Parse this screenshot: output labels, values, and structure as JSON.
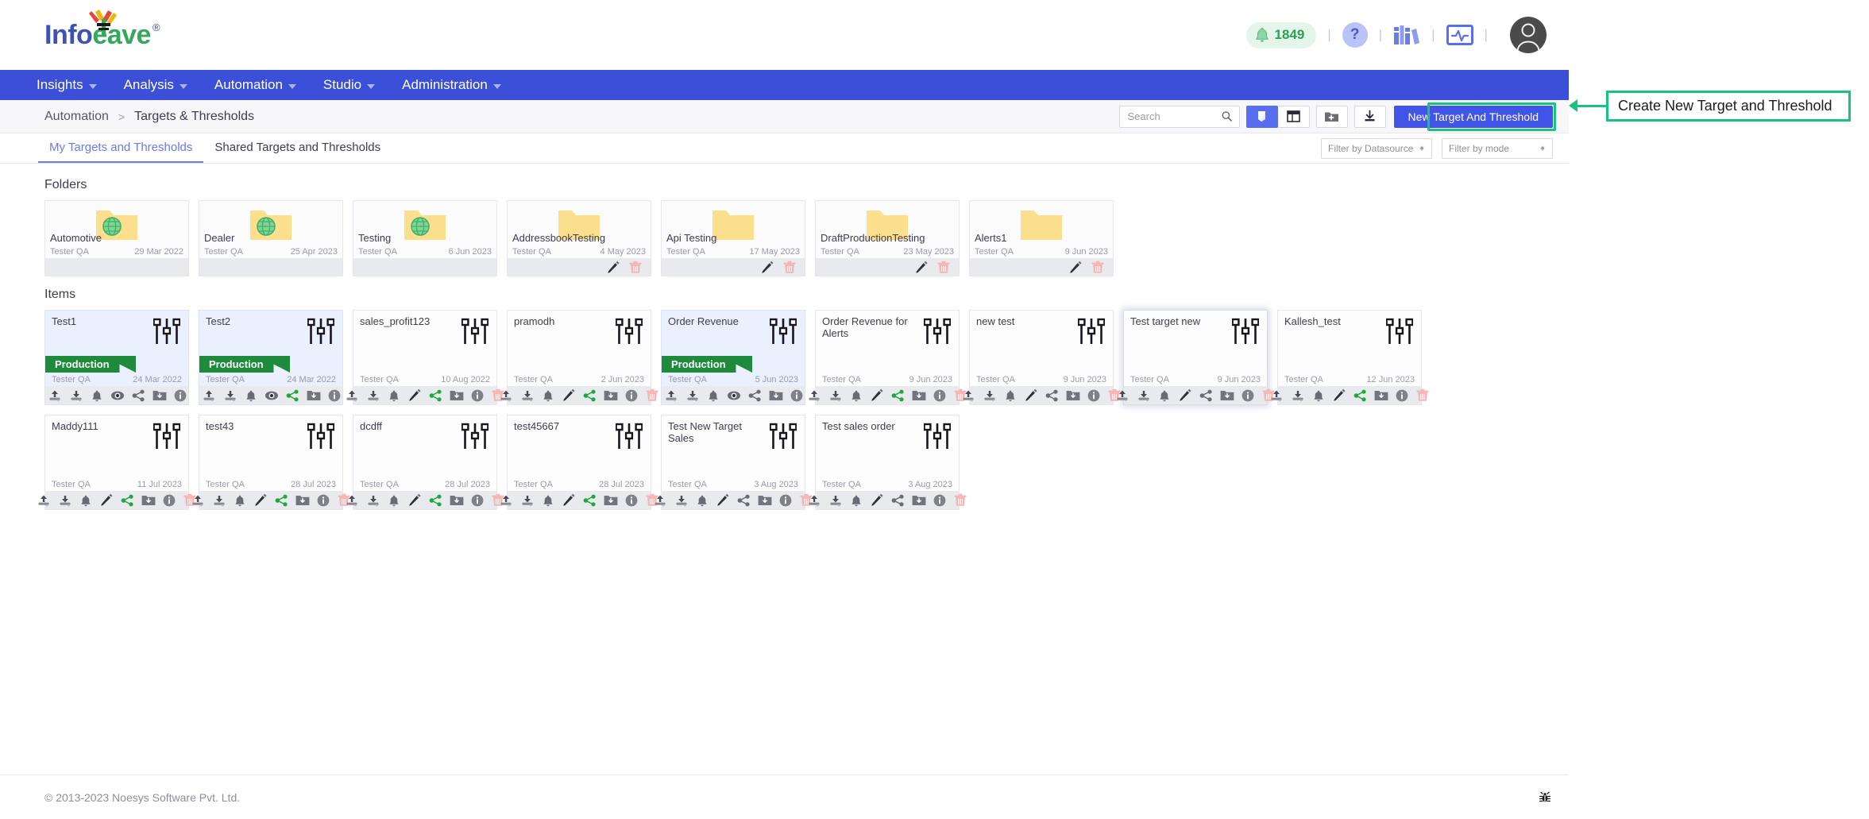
{
  "brand": {
    "name_part1": "Info",
    "name_part2": "eave",
    "trademark": "®"
  },
  "header": {
    "notification_count": "1849",
    "bell_icon": "bell-icon",
    "help_label": "?",
    "library_icon": "library-icon",
    "monitor_icon": "monitor-icon",
    "avatar_icon": "user-avatar-icon",
    "separator": "|",
    "accent_green": "#2e9e57",
    "accent_blue": "#3b4fd8"
  },
  "nav": {
    "items": [
      {
        "label": "Insights",
        "has_caret": true
      },
      {
        "label": "Analysis",
        "has_caret": true
      },
      {
        "label": "Automation",
        "has_caret": true
      },
      {
        "label": "Studio",
        "has_caret": true
      },
      {
        "label": "Administration",
        "has_caret": true
      }
    ]
  },
  "breadcrumb": {
    "parent": "Automation",
    "separator": ">",
    "current": "Targets & Thresholds"
  },
  "toolbar": {
    "search_placeholder": "Search",
    "search_value": "",
    "search_icon": "search-icon",
    "view_card_icon": "card-view-icon",
    "view_list_icon": "list-view-icon",
    "new_folder_icon": "new-folder-icon",
    "import_icon": "import-download-icon",
    "primary_button": "New Target And Threshold"
  },
  "tabs": [
    {
      "label": "My Targets and Thresholds",
      "active": true
    },
    {
      "label": "Shared Targets and Thresholds",
      "active": false
    }
  ],
  "filters": [
    {
      "label": "Filter by Datasource"
    },
    {
      "label": "Filter by mode"
    }
  ],
  "sections": {
    "folders_title": "Folders",
    "items_title": "Items"
  },
  "folders": [
    {
      "name": "Automotive",
      "owner": "Tester QA",
      "date": "29 Mar 2022",
      "shared": true,
      "actions": []
    },
    {
      "name": "Dealer",
      "owner": "Tester QA",
      "date": "25 Apr 2023",
      "shared": true,
      "actions": []
    },
    {
      "name": "Testing",
      "owner": "Tester QA",
      "date": "6 Jun 2023",
      "shared": true,
      "actions": []
    },
    {
      "name": "AddressbookTesting",
      "owner": "Tester QA",
      "date": "4 May 2023",
      "shared": false,
      "actions": [
        "edit",
        "delete"
      ]
    },
    {
      "name": "Api Testing",
      "owner": "Tester QA",
      "date": "17 May 2023",
      "shared": false,
      "actions": [
        "edit",
        "delete"
      ]
    },
    {
      "name": "DraftProductionTesting",
      "owner": "Tester QA",
      "date": "23 May 2023",
      "shared": false,
      "actions": [
        "edit",
        "delete"
      ]
    },
    {
      "name": "Alerts1",
      "owner": "Tester QA",
      "date": "9 Jun 2023",
      "shared": false,
      "actions": [
        "edit",
        "delete"
      ]
    }
  ],
  "items": [
    {
      "name": "Test1",
      "owner": "Tester QA",
      "date": "24 Mar 2022",
      "ribbon": "Production",
      "production": true,
      "hover": false,
      "actions": [
        "upload",
        "download",
        "bell",
        "eye",
        "share-off",
        "folder",
        "info"
      ]
    },
    {
      "name": "Test2",
      "owner": "Tester QA",
      "date": "24 Mar 2022",
      "ribbon": "Production",
      "production": true,
      "hover": false,
      "actions": [
        "upload",
        "download",
        "bell",
        "eye",
        "share-on",
        "folder",
        "info"
      ]
    },
    {
      "name": "sales_profit123",
      "owner": "Tester QA",
      "date": "10 Aug 2022",
      "ribbon": "",
      "production": false,
      "hover": false,
      "actions": [
        "upload",
        "download",
        "bell",
        "edit",
        "share-on",
        "folder",
        "info",
        "delete"
      ]
    },
    {
      "name": "pramodh",
      "owner": "Tester QA",
      "date": "2 Jun 2023",
      "ribbon": "",
      "production": false,
      "hover": false,
      "actions": [
        "upload",
        "download",
        "bell",
        "edit",
        "share-on",
        "folder",
        "info",
        "delete"
      ]
    },
    {
      "name": "Order Revenue",
      "owner": "Tester QA",
      "date": "5 Jun 2023",
      "ribbon": "Production",
      "production": true,
      "hover": false,
      "actions": [
        "upload",
        "download",
        "bell",
        "eye",
        "share-off",
        "folder",
        "info"
      ]
    },
    {
      "name": "Order Revenue for Alerts",
      "owner": "Tester QA",
      "date": "9 Jun 2023",
      "ribbon": "",
      "production": false,
      "hover": false,
      "actions": [
        "upload",
        "download",
        "bell",
        "edit",
        "share-on",
        "folder",
        "info",
        "delete"
      ]
    },
    {
      "name": "new test",
      "owner": "Tester QA",
      "date": "9 Jun 2023",
      "ribbon": "",
      "production": false,
      "hover": false,
      "actions": [
        "upload",
        "download",
        "bell",
        "edit",
        "share-off",
        "folder",
        "info",
        "delete"
      ]
    },
    {
      "name": "Test target new",
      "owner": "Tester QA",
      "date": "9 Jun 2023",
      "ribbon": "",
      "production": false,
      "hover": true,
      "actions": [
        "upload",
        "download",
        "bell",
        "edit",
        "share-off",
        "folder",
        "info",
        "delete"
      ]
    },
    {
      "name": "Kallesh_test",
      "owner": "Tester QA",
      "date": "12 Jun 2023",
      "ribbon": "",
      "production": false,
      "hover": false,
      "actions": [
        "upload",
        "download",
        "bell",
        "edit",
        "share-on",
        "folder",
        "info",
        "delete"
      ]
    },
    {
      "name": "Maddy111",
      "owner": "Tester QA",
      "date": "11 Jul 2023",
      "ribbon": "",
      "production": false,
      "hover": false,
      "actions": [
        "upload",
        "download",
        "bell",
        "edit",
        "share-on",
        "folder",
        "info",
        "delete"
      ]
    },
    {
      "name": "test43",
      "owner": "Tester QA",
      "date": "28 Jul 2023",
      "ribbon": "",
      "production": false,
      "hover": false,
      "actions": [
        "upload",
        "download",
        "bell",
        "edit",
        "share-on",
        "folder",
        "info",
        "delete"
      ]
    },
    {
      "name": "dcdff",
      "owner": "Tester QA",
      "date": "28 Jul 2023",
      "ribbon": "",
      "production": false,
      "hover": false,
      "actions": [
        "upload",
        "download",
        "bell",
        "edit",
        "share-on",
        "folder",
        "info",
        "delete"
      ]
    },
    {
      "name": "test45667",
      "owner": "Tester QA",
      "date": "28 Jul 2023",
      "ribbon": "",
      "production": false,
      "hover": false,
      "actions": [
        "upload",
        "download",
        "bell",
        "edit",
        "share-on",
        "folder",
        "info",
        "delete"
      ]
    },
    {
      "name": "Test New Target Sales",
      "owner": "Tester QA",
      "date": "3 Aug 2023",
      "ribbon": "",
      "production": false,
      "hover": false,
      "actions": [
        "upload",
        "download",
        "bell",
        "edit",
        "share-off",
        "folder",
        "info",
        "delete"
      ]
    },
    {
      "name": "Test sales order",
      "owner": "Tester QA",
      "date": "3 Aug 2023",
      "ribbon": "",
      "production": false,
      "hover": false,
      "actions": [
        "upload",
        "download",
        "bell",
        "edit",
        "share-off",
        "folder",
        "info",
        "delete"
      ]
    }
  ],
  "footer": {
    "copyright": "© 2013-2023 Noesys Software Pvt. Ltd.",
    "debug_icon": "bug-icon"
  },
  "annotation": {
    "text": "Create New Target and Threshold",
    "color": "#17c47e"
  }
}
